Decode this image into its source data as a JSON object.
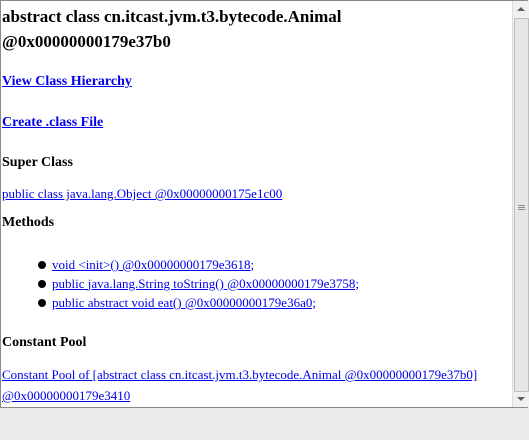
{
  "page": {
    "title": "abstract class cn.itcast.jvm.t3.bytecode.Animal @0x00000000179e37b0",
    "view_hierarchy_label": "View Class Hierarchy",
    "create_class_file_label": "Create .class File",
    "super_class_heading": "Super Class",
    "super_class_link": "public class java.lang.Object @0x00000000175e1c00",
    "methods_heading": "Methods",
    "methods": [
      "void <init>() @0x00000000179e3618;",
      "public java.lang.String toString() @0x00000000179e3758;",
      "public abstract void eat() @0x00000000179e36a0;"
    ],
    "constant_pool_heading": "Constant Pool",
    "constant_pool_link": "Constant Pool of [abstract class cn.itcast.jvm.t3.bytecode.Animal @0x00000000179e37b0] @0x00000000179e3410"
  },
  "icons": {
    "scroll_up": "triangle-up-icon",
    "scroll_down": "triangle-down-icon",
    "method_bullet": "bullet-dot-icon"
  }
}
